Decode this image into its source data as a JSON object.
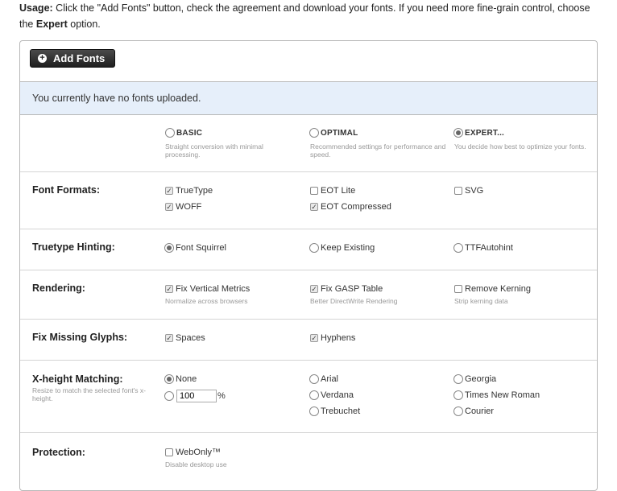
{
  "usage": {
    "label": "Usage:",
    "text1": " Click the \"Add Fonts\" button, check the agreement and download your fonts. If you need more fine-grain control, choose the ",
    "strong": "Expert",
    "text2": " option."
  },
  "toolbar": {
    "add_fonts_label": "Add Fonts",
    "add_icon": "plus-circle-icon"
  },
  "notice": "You currently have no fonts uploaded.",
  "modes": [
    {
      "label": "BASIC",
      "desc": "Straight conversion with minimal processing.",
      "selected": false
    },
    {
      "label": "OPTIMAL",
      "desc": "Recommended settings for performance and speed.",
      "selected": false
    },
    {
      "label": "EXPERT...",
      "desc": "You decide how best to optimize your fonts.",
      "selected": true
    }
  ],
  "font_formats": {
    "label": "Font Formats:",
    "options": [
      {
        "label": "TrueType",
        "checked": true
      },
      {
        "label": "WOFF",
        "checked": true
      },
      {
        "label": "EOT Lite",
        "checked": false
      },
      {
        "label": "EOT Compressed",
        "checked": true
      },
      {
        "label": "SVG",
        "checked": false
      }
    ]
  },
  "hinting": {
    "label": "Truetype Hinting:",
    "options": [
      {
        "label": "Font Squirrel",
        "selected": true
      },
      {
        "label": "Keep Existing",
        "selected": false
      },
      {
        "label": "TTFAutohint",
        "selected": false
      }
    ]
  },
  "rendering": {
    "label": "Rendering:",
    "options": [
      {
        "label": "Fix Vertical Metrics",
        "desc": "Normalize across browsers",
        "checked": true
      },
      {
        "label": "Fix GASP Table",
        "desc": "Better DirectWrite Rendering",
        "checked": true
      },
      {
        "label": "Remove Kerning",
        "desc": "Strip kerning data",
        "checked": false
      }
    ]
  },
  "missing_glyphs": {
    "label": "Fix Missing Glyphs:",
    "options": [
      {
        "label": "Spaces",
        "checked": true
      },
      {
        "label": "Hyphens",
        "checked": true
      }
    ]
  },
  "xheight": {
    "label": "X-height Matching:",
    "sub": "Resize to match the selected font's x-height.",
    "none_label": "None",
    "pct_value": "100",
    "pct_unit": "%",
    "fonts": [
      "Arial",
      "Verdana",
      "Trebuchet",
      "Georgia",
      "Times New Roman",
      "Courier"
    ]
  },
  "protection": {
    "label": "Protection:",
    "webonly_label": "WebOnly™",
    "webonly_desc": "Disable desktop use"
  }
}
